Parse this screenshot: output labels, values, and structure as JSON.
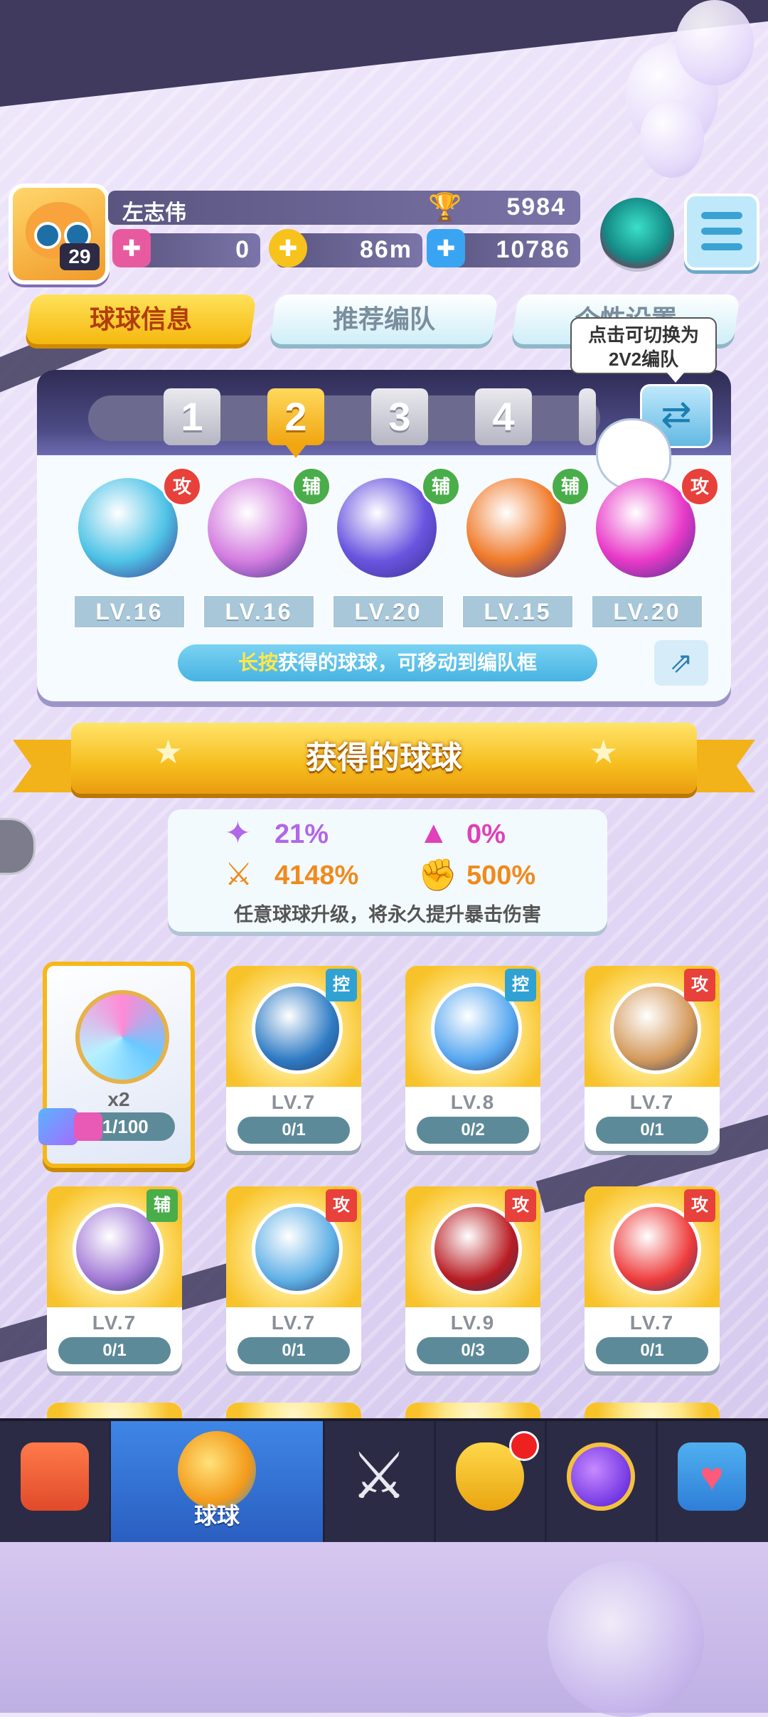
{
  "player": {
    "name": "左志伟",
    "level": "29",
    "trophies": "5984",
    "vouchers": "0",
    "coins": "86m",
    "diamonds": "10786"
  },
  "tabs": [
    "球球信息",
    "推荐编队",
    "个性设置"
  ],
  "tooltip": {
    "line1": "点击可切换为",
    "line2": "2V2编队"
  },
  "team_slots": [
    "1",
    "2",
    "3",
    "4"
  ],
  "active_slot": "2",
  "team": [
    {
      "level": "LV.16",
      "role": "攻",
      "color": "#4fc3e6"
    },
    {
      "level": "LV.16",
      "role": "辅",
      "color": "#d47ee0"
    },
    {
      "level": "LV.20",
      "role": "辅",
      "color": "#6a55e0"
    },
    {
      "level": "LV.15",
      "role": "辅",
      "color": "#f07a2a"
    },
    {
      "level": "LV.20",
      "role": "攻",
      "color": "#e83ac8"
    }
  ],
  "hint": {
    "highlight": "长按",
    "text": "获得的球球，可移动到编队框"
  },
  "section_title": "获得的球球",
  "stats": {
    "stat1": "21%",
    "stat2": "0%",
    "stat3": "4148%",
    "stat4": "500%",
    "note": "任意球球升级，将永久提升暴击伤害"
  },
  "special_card": {
    "multiplier": "x2",
    "progress": "31/100"
  },
  "balls": [
    {
      "level": "LV.7",
      "progress": "0/1",
      "role": "控",
      "color": "#2e7bc4"
    },
    {
      "level": "LV.8",
      "progress": "0/2",
      "role": "控",
      "color": "#58a8f0"
    },
    {
      "level": "LV.7",
      "progress": "0/1",
      "role": "攻",
      "color": "#d49a5c"
    },
    {
      "level": "LV.7",
      "progress": "0/1",
      "role": "辅",
      "color": "#a37ad6"
    },
    {
      "level": "LV.7",
      "progress": "0/1",
      "role": "攻",
      "color": "#5fb0e6"
    },
    {
      "level": "LV.9",
      "progress": "0/3",
      "role": "攻",
      "color": "#b81c22"
    },
    {
      "level": "LV.7",
      "progress": "0/1",
      "role": "攻",
      "color": "#ee3b3b"
    }
  ],
  "nav": {
    "active_label": "球球"
  },
  "colors": {
    "attack": "#e8403a",
    "support": "#49ad4a",
    "control": "#2fa2d3",
    "gold": "#f6bd1e"
  }
}
